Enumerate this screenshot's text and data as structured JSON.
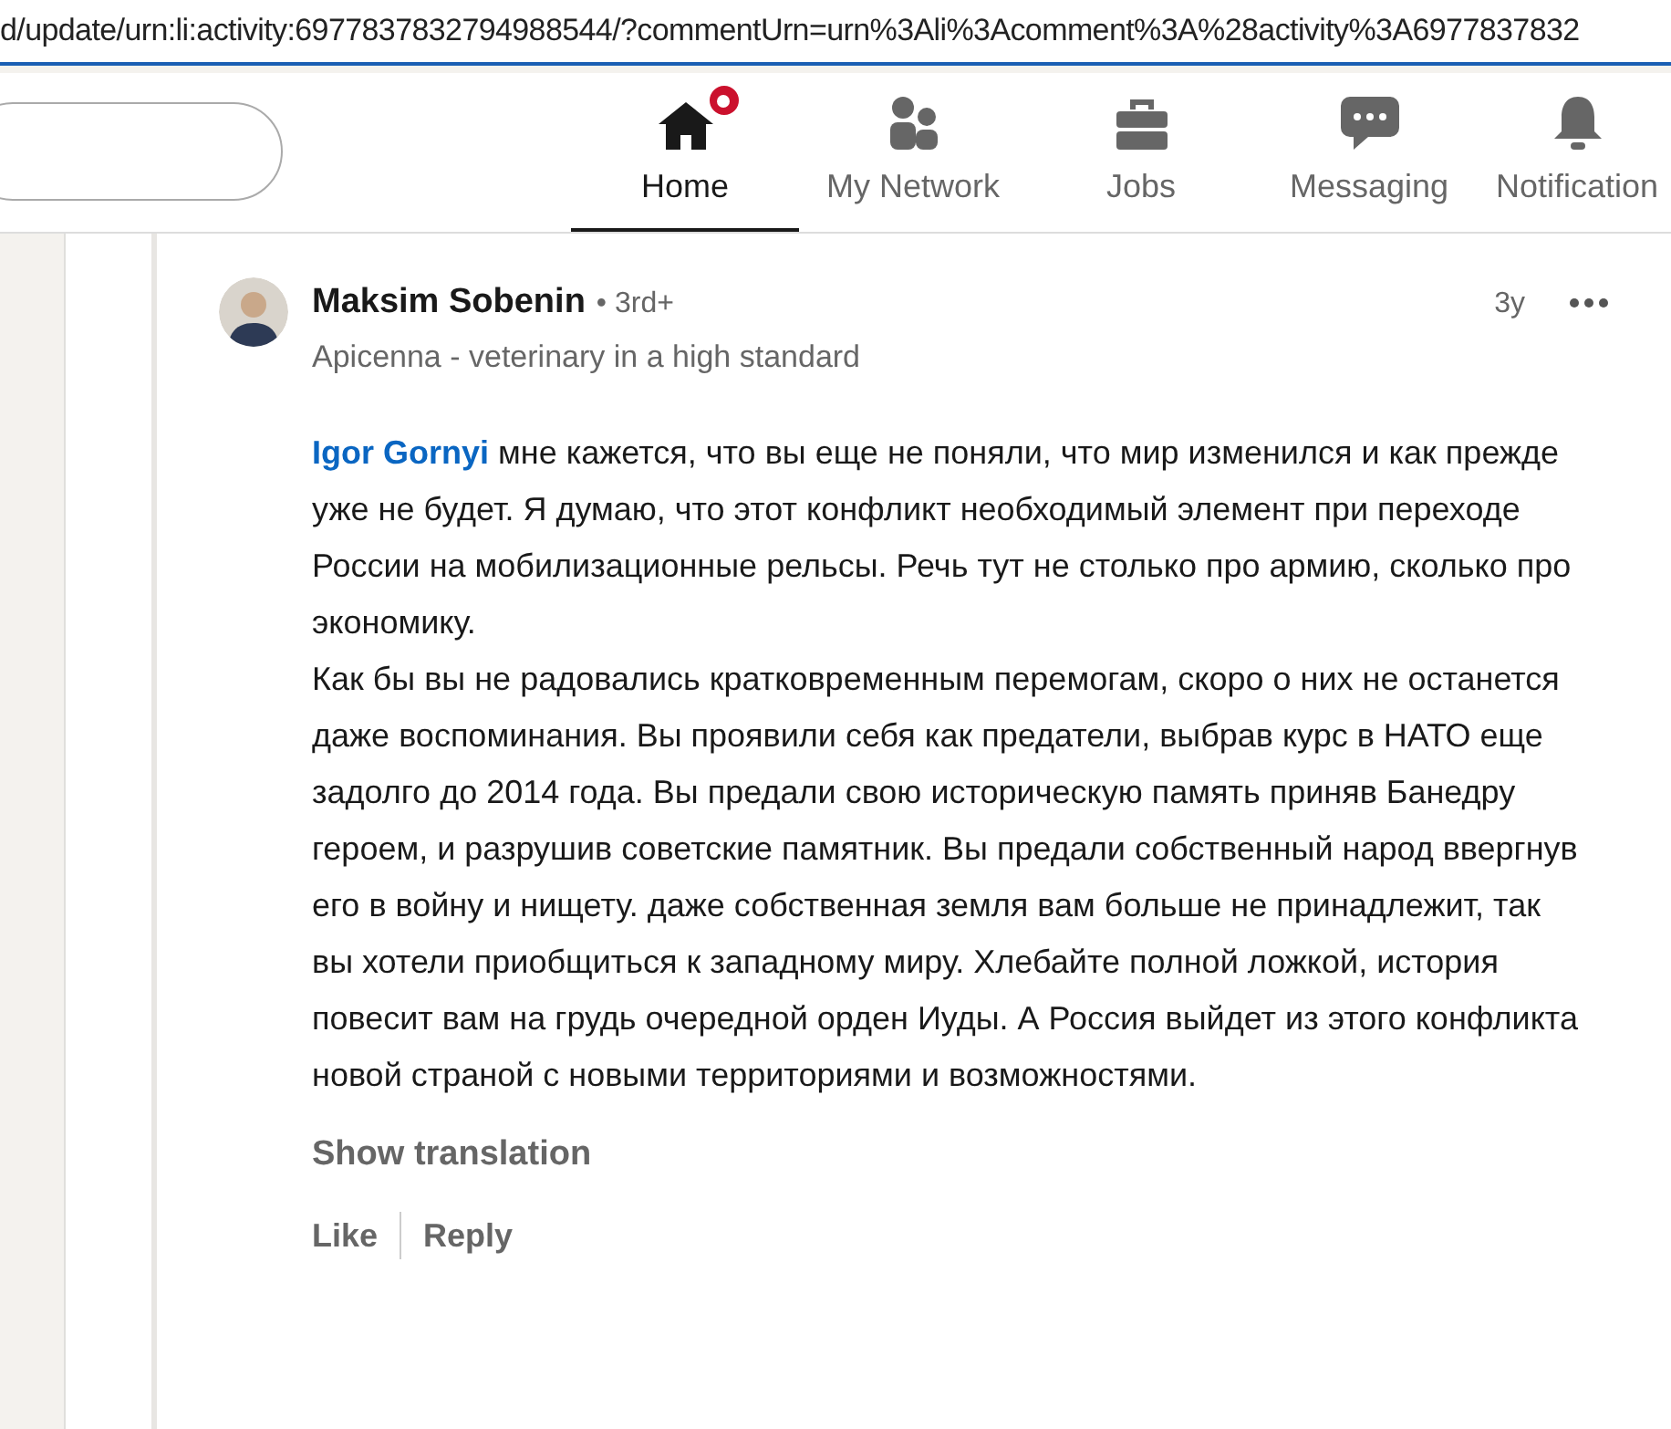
{
  "address_bar": {
    "url": "d/update/urn:li:activity:6977837832794988544/?commentUrn=urn%3Ali%3Acomment%3A%28activity%3A6977837832"
  },
  "nav": [
    {
      "label": "Home",
      "selected": true,
      "badge": true
    },
    {
      "label": "My Network",
      "selected": false,
      "badge": false
    },
    {
      "label": "Jobs",
      "selected": false,
      "badge": false
    },
    {
      "label": "Messaging",
      "selected": false,
      "badge": false
    },
    {
      "label": "Notification",
      "selected": false,
      "badge": false
    }
  ],
  "comment": {
    "author": "Maksim Sobenin",
    "degree": "• 3rd+",
    "headline": "Apicenna - veterinary in a high standard",
    "time": "3y",
    "mention": "Igor Gornyi",
    "paragraphs": [
      "мне кажется, что вы еще не поняли, что мир изменился и как прежде уже не будет. Я думаю, что этот конфликт необходимый элемент при переходе России на мобилизационные рельсы. Речь тут не столько про армию, сколько про экономику.",
      "Как бы вы не радовались кратковременным перемогам, скоро о них не останется даже воспоминания. Вы проявили себя как предатели, выбрав курс в НАТО еще задолго до 2014 года. Вы предали свою историческую память приняв Банедру героем, и разрушив советские памятник. Вы предали собственный народ ввергнув его в войну и нищету. даже собственная земля вам больше не принадлежит, так вы хотели приобщиться к западному миру. Хлебайте полной ложкой, история повесит вам на грудь очередной орден Иуды. А Россия выйдет из этого конфликта новой страной с новыми территориями и возможностями."
    ],
    "show_translation": "Show translation",
    "actions": [
      "Like",
      "Reply"
    ]
  }
}
